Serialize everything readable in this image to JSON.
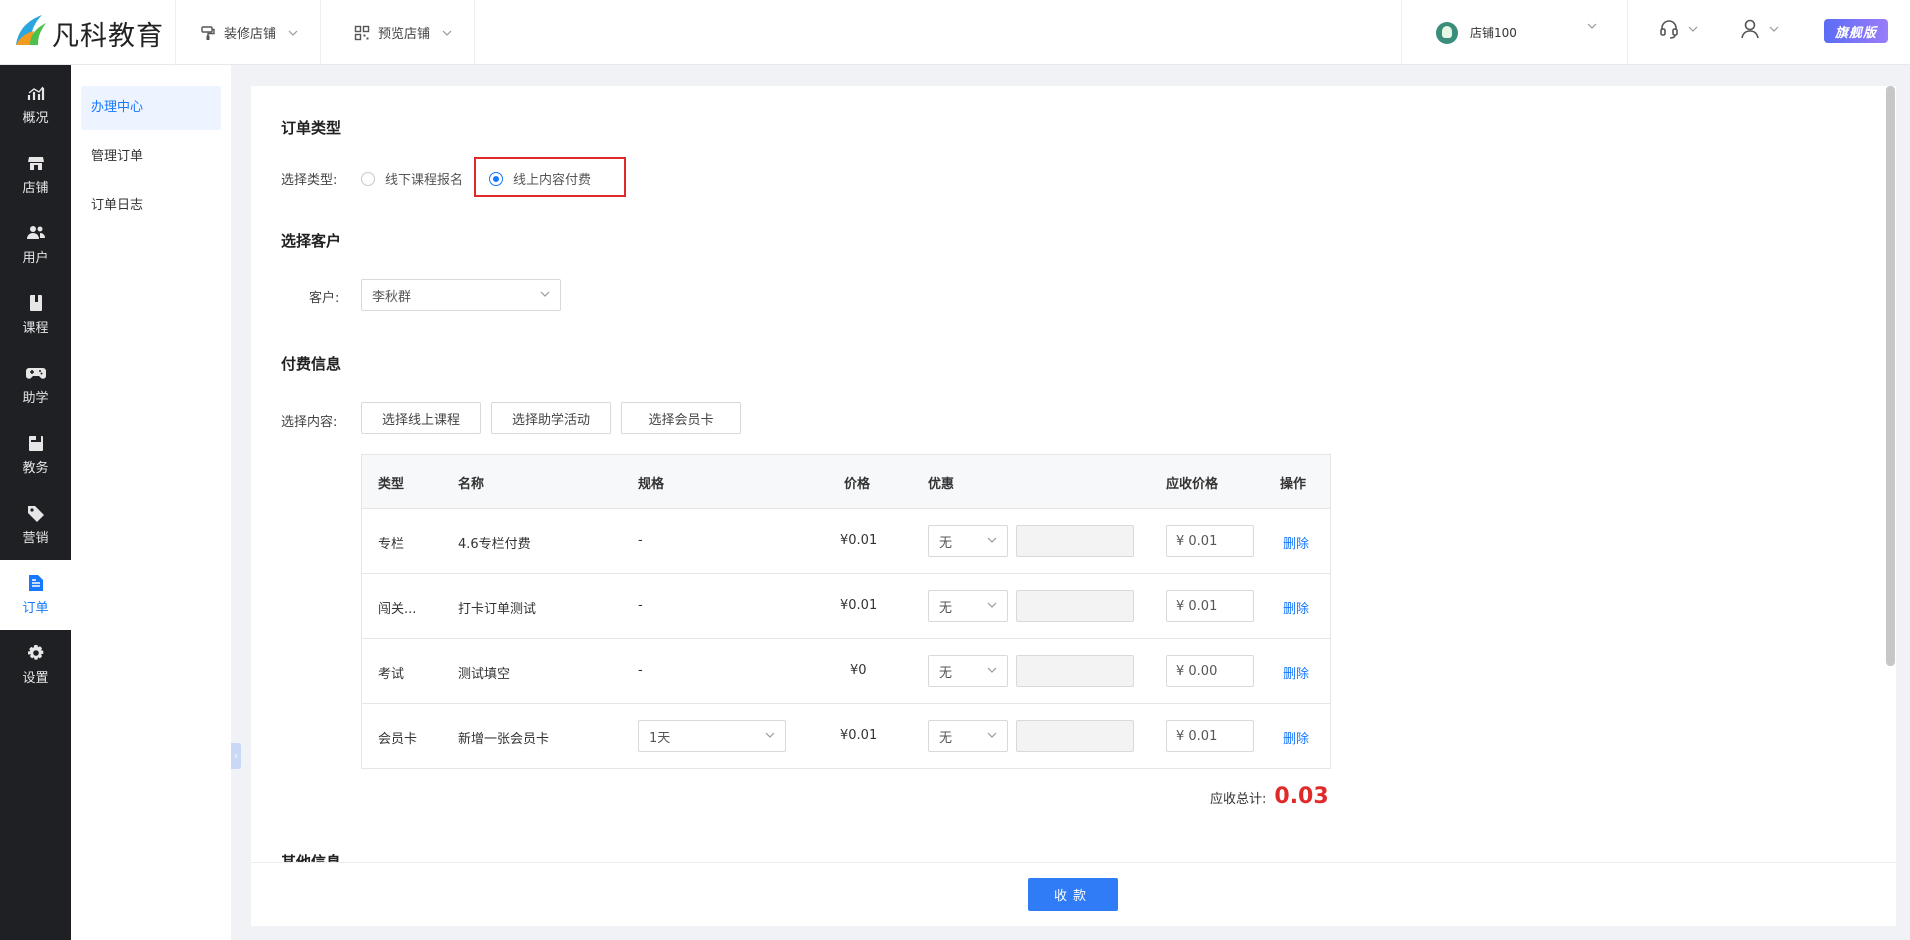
{
  "header": {
    "logo_text": "凡科教育",
    "nav": [
      {
        "label": "装修店铺",
        "icon": "paint-roller-icon"
      },
      {
        "label": "预览店铺",
        "icon": "qrcode-icon"
      }
    ],
    "store_name": "店铺100",
    "vip_badge": "旗舰版"
  },
  "sidebar": {
    "items": [
      {
        "label": "概况",
        "icon": "chart-icon"
      },
      {
        "label": "店铺",
        "icon": "store-icon"
      },
      {
        "label": "用户",
        "icon": "users-icon"
      },
      {
        "label": "课程",
        "icon": "book-icon"
      },
      {
        "label": "助学",
        "icon": "gamepad-icon"
      },
      {
        "label": "教务",
        "icon": "calendar-icon"
      },
      {
        "label": "营销",
        "icon": "tag-icon"
      },
      {
        "label": "订单",
        "icon": "document-icon",
        "active": true
      },
      {
        "label": "设置",
        "icon": "gear-icon"
      }
    ]
  },
  "subnav": {
    "items": [
      {
        "label": "办理中心",
        "active": true
      },
      {
        "label": "管理订单"
      },
      {
        "label": "订单日志"
      }
    ]
  },
  "order_type": {
    "title": "订单类型",
    "label": "选择类型:",
    "options": [
      "线下课程报名",
      "线上内容付费"
    ],
    "selected": "线上内容付费"
  },
  "customer": {
    "title": "选择客户",
    "label": "客户:",
    "value": "李秋群"
  },
  "payment": {
    "title": "付费信息",
    "label": "选择内容:",
    "buttons": [
      "选择线上课程",
      "选择助学活动",
      "选择会员卡"
    ],
    "columns": [
      "类型",
      "名称",
      "规格",
      "价格",
      "优惠",
      "应收价格",
      "操作"
    ],
    "rows": [
      {
        "type": "专栏",
        "name": "4.6专栏付费",
        "spec": "-",
        "price": "¥0.01",
        "discount": "无",
        "receivable": "¥ 0.01",
        "action": "删除"
      },
      {
        "type": "闯关...",
        "name": "打卡订单测试",
        "spec": "-",
        "price": "¥0.01",
        "discount": "无",
        "receivable": "¥ 0.01",
        "action": "删除"
      },
      {
        "type": "考试",
        "name": "测试填空",
        "spec": "-",
        "price": "¥0",
        "discount": "无",
        "receivable": "¥ 0.00",
        "action": "删除"
      },
      {
        "type": "会员卡",
        "name": "新增一张会员卡",
        "spec": "1天",
        "price": "¥0.01",
        "discount": "无",
        "receivable": "¥ 0.01",
        "action": "删除"
      }
    ],
    "total_label": "应收总计:",
    "total_value": "0.03"
  },
  "other_info_title": "其他信息",
  "submit_label": "收款",
  "colors": {
    "accent": "#1677ff",
    "danger": "#e02a2a",
    "sidebar_bg": "#1e2023"
  }
}
